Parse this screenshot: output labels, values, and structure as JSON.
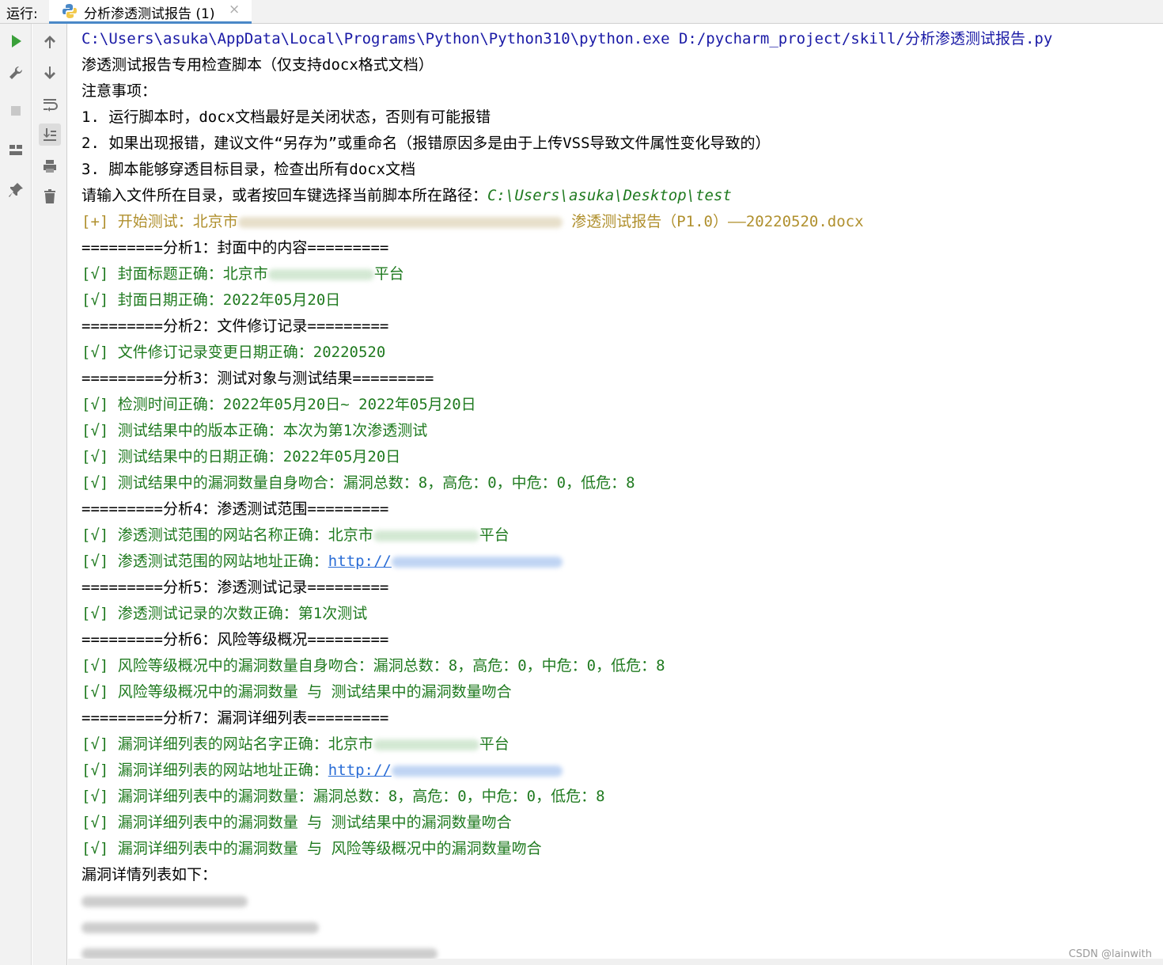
{
  "run_bar": {
    "label": "运行:",
    "tab_title": "分析渗透测试报告 (1)",
    "tab_close": "×"
  },
  "toolbar": {
    "left_icons": [
      "run-icon",
      "wrench-icon",
      "stop-icon",
      "layout-icon",
      "pin-icon"
    ],
    "second_icons": [
      "arrow-up-icon",
      "arrow-down-icon",
      "soft-wrap-icon",
      "scroll-to-end-icon",
      "print-icon",
      "trash-icon"
    ]
  },
  "console": {
    "cmd": "C:\\Users\\asuka\\AppData\\Local\\Programs\\Python\\Python310\\python.exe D:/pycharm_project/skill/分析渗透测试报告.py",
    "header": "渗透测试报告专用检查脚本（仅支持docx格式文档）",
    "notes_title": "注意事项：",
    "note1": "1. 运行脚本时，docx文档最好是关闭状态，否则有可能报错",
    "note2": "2. 如果出现报错，建议文件“另存为”或重命名（报错原因多是由于上传VSS导致文件属性变化导致的）",
    "note3": "3. 脚本能够穿透目标目录，检查出所有docx文档",
    "prompt": "请输入文件所在目录，或者按回车键选择当前脚本所在路径：",
    "prompt_path": "C:\\Users\\asuka\\Desktop\\test",
    "start_prefix": "[+] 开始测试：北京市",
    "start_suffix": " 渗透测试报告（P1.0）——20220520.docx",
    "sec1": "=========分析1：封面中的内容=========",
    "r_cover_title": "[√] 封面标题正确：北京市",
    "r_cover_title_tail": "平台",
    "r_cover_date": "[√] 封面日期正确：2022年05月20日",
    "sec2": "=========分析2：文件修订记录=========",
    "r_rev_date": "[√] 文件修订记录变更日期正确：20220520",
    "sec3": "=========分析3：测试对象与测试结果=========",
    "r_check_time": "[√] 检测时间正确：2022年05月20日~ 2022年05月20日",
    "r_version": "[√] 测试结果中的版本正确：本次为第1次渗透测试",
    "r_result_date": "[√] 测试结果中的日期正确：2022年05月20日",
    "r_result_count": "[√] 测试结果中的漏洞数量自身吻合：漏洞总数：8，高危：0，中危：0，低危：8",
    "sec4": "=========分析4：渗透测试范围=========",
    "r_scope_name": "[√] 渗透测试范围的网站名称正确：北京市",
    "r_scope_name_tail": "平台",
    "r_scope_url": "[√] 渗透测试范围的网站地址正确：",
    "link_text": "http://",
    "sec5": "=========分析5：渗透测试记录=========",
    "r_record_count": "[√] 渗透测试记录的次数正确：第1次测试",
    "sec6": "=========分析6：风险等级概况=========",
    "r_risk_count": "[√] 风险等级概况中的漏洞数量自身吻合：漏洞总数：8，高危：0，中危：0，低危：8",
    "r_risk_match": "[√] 风险等级概况中的漏洞数量 与 测试结果中的漏洞数量吻合",
    "sec7": "=========分析7：漏洞详细列表=========",
    "r_list_name": "[√] 漏洞详细列表的网站名字正确：北京市",
    "r_list_name_tail": "平台",
    "r_list_url": "[√] 漏洞详细列表的网站地址正确：",
    "r_list_count": "[√] 漏洞详细列表中的漏洞数量：漏洞总数：8，高危：0，中危：0，低危：8",
    "r_list_match1": "[√] 漏洞详细列表中的漏洞数量 与 测试结果中的漏洞数量吻合",
    "r_list_match2": "[√] 漏洞详细列表中的漏洞数量 与 风险等级概况中的漏洞数量吻合",
    "detail_title": "漏洞详情列表如下："
  },
  "watermark": "CSDN @lainwith",
  "colors": {
    "command": "#1a1aa6",
    "success": "#1f7a1f",
    "info": "#b0902e",
    "link": "#2a6dd6",
    "accent_tab": "#4a88c7"
  }
}
